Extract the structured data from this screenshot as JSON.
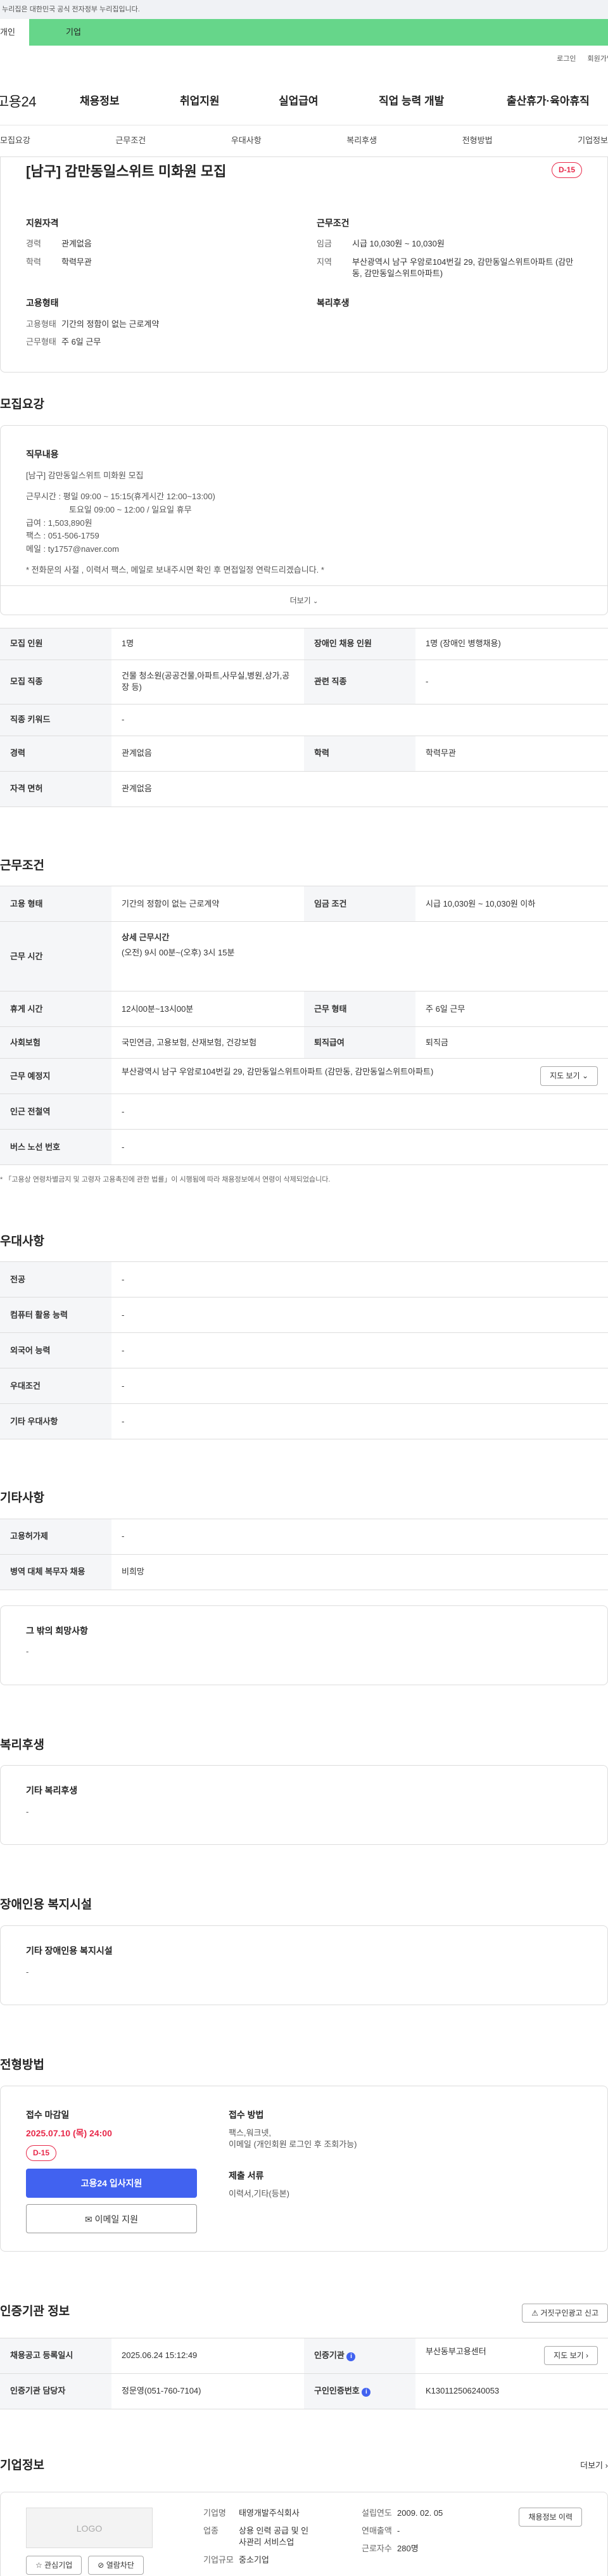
{
  "gov_banner": "이 누리집은 대한민국 공식 전자정부 누리집입니다.",
  "sub_tabs": [
    "개인",
    "기업"
  ],
  "util_links": [
    "로그인",
    "회원가입"
  ],
  "logo": "고용24",
  "gnb": [
    "채용정보",
    "취업지원",
    "실업급여",
    "직업 능력 개발",
    "출산휴가·육아휴직"
  ],
  "anchors": [
    "모집요강",
    "근무조건",
    "우대사항",
    "복리후생",
    "전형방법",
    "기업정보"
  ],
  "header": {
    "title": "[남구] 감만동일스위트 미화원 모집",
    "dday": "D-15",
    "qual_heading": "지원자격",
    "cond_heading": "근무조건",
    "emp_heading": "고용형태",
    "welfare_heading": "복리후생",
    "qual": [
      {
        "k": "경력",
        "v": "관계없음"
      },
      {
        "k": "학력",
        "v": "학력무관"
      }
    ],
    "cond": [
      {
        "k": "임금",
        "v": "시급 10,030원 ~ 10,030원"
      },
      {
        "k": "지역",
        "v": "부산광역시 남구 우암로104번길 29, 감만동일스위트아파트 (감만동, 감만동일스위트아파트)"
      }
    ],
    "emp": [
      {
        "k": "고용형태",
        "v": "기간의 정함이 없는 근로계약"
      },
      {
        "k": "근무형태",
        "v": "주 6일 근무"
      }
    ]
  },
  "recruit": {
    "section_title": "모집요강",
    "duty_heading": "직무내용",
    "duty_lines": [
      "[남구] 감만동일스위트 미화원 모집",
      "",
      "근무시간 : 평일 09:00 ~ 15:15(휴게시간 12:00~13:00)",
      "            토요일 09:00 ~ 12:00 / 일요일 휴무",
      "급여 : 1,503,890원",
      "팩스 : 051-506-1759",
      "메일 : ty1757@naver.com",
      "",
      "* 전화문의 사절 , 이력서 팩스, 메일로 보내주시면 확인 후 면접일정 연락드리겠습니다. *"
    ],
    "more": "더보기",
    "rows": [
      {
        "k1": "모집 인원",
        "v1": "1명",
        "k2": "장애인 채용 인원",
        "v2": "1명 (장애인 병행채용)"
      },
      {
        "k1": "모집 직종",
        "v1": "건물 청소원(공공건물,아파트,사무실,병원,상가,공장 등)",
        "k2": "관련 직종",
        "v2": "-"
      },
      {
        "k1": "직종 키워드",
        "v1": "-"
      },
      {
        "k1": "경력",
        "v1": "관계없음",
        "k2": "학력",
        "v2": "학력무관"
      },
      {
        "k1": "자격 면허",
        "v1": "관계없음"
      }
    ]
  },
  "conditions": {
    "section_title": "근무조건",
    "employ_type_k": "고용 형태",
    "employ_type_v": "기간의 정함이 없는 근로계약",
    "wage_k": "임금 조건",
    "wage_v": "시급 10,030원 ~ 10,030원 이하",
    "hours_k": "근무 시간",
    "hours_sub": "상세 근무시간",
    "hours_v": "(오전) 9시 00분~(오후) 3시 15분",
    "rest_k": "휴게 시간",
    "rest_v": "12시00분~13시00분",
    "form_k": "근무 형태",
    "form_v": "주 6일 근무",
    "ins_k": "사회보험",
    "ins_v": "국민연금, 고용보험, 산재보험, 건강보험",
    "sev_k": "퇴직급여",
    "sev_v": "퇴직금",
    "loc_k": "근무 예정지",
    "loc_v": "부산광역시 남구 우암로104번길 29, 감만동일스위트아파트 (감만동, 감만동일스위트아파트)",
    "map_btn": "지도 보기",
    "subway_k": "인근 전철역",
    "subway_v": "-",
    "bus_k": "버스 노선 번호",
    "bus_v": "-",
    "note": "* 「고용상 연령차별금지 및 고령자 고용촉진에 관한 법률」이 시행됨에 따라 채용정보에서 연령이 삭제되었습니다."
  },
  "preference": {
    "section_title": "우대사항",
    "rows": [
      {
        "k": "전공",
        "v": "-"
      },
      {
        "k": "컴퓨터 활용 능력",
        "v": "-"
      },
      {
        "k": "외국어 능력",
        "v": "-"
      },
      {
        "k": "우대조건",
        "v": "-"
      },
      {
        "k": "기타 우대사항",
        "v": "-"
      }
    ]
  },
  "etc": {
    "section_title": "기타사항",
    "rows": [
      {
        "k": "고용허가제",
        "v": "-"
      },
      {
        "k": "병역 대체 복무자 채용",
        "v": "비희망"
      }
    ],
    "wish_title": "그 밖의 희망사항",
    "wish_v": "-"
  },
  "welfare": {
    "section_title": "복리후생",
    "panel_title": "기타 복리후생",
    "v": "-"
  },
  "disabled": {
    "section_title": "장애인용 복지시설",
    "panel_title": "기타 장애인용 복지시설",
    "v": "-"
  },
  "process": {
    "section_title": "전형방법",
    "deadline_title": "접수 마감일",
    "deadline": "2025.07.10 (목) 24:00",
    "dday": "D-15",
    "apply_btn": "고용24 입사지원",
    "email_btn": "이메일 지원",
    "method_title": "접수 방법",
    "method_lines": [
      "팩스,워크넷,",
      "이메일 (개인회원 로그인 후 조회가능)"
    ],
    "docs_title": "제출 서류",
    "docs": "이력서,기타(등본)"
  },
  "cert": {
    "section_title": "인증기관 정보",
    "report_btn": "거짓구인광고 신고",
    "reg_k": "채용공고 등록일시",
    "reg_v": "2025.06.24 15:12:49",
    "org_k": "인증기관",
    "org_v": "부산동부고용센터",
    "map_btn": "지도 보기",
    "mgr_k": "인증기관 담당자",
    "mgr_v": "정문영(051-760-7104)",
    "cert_k": "구인인증번호",
    "cert_v": "K130112506240053"
  },
  "company": {
    "section_title": "기업정보",
    "more": "더보기",
    "logo_text": "LOGO",
    "interest_btn": "관심기업",
    "block_btn": "열람차단",
    "name_k": "기업명",
    "name_v": "태영개발주식회사",
    "found_k": "설립연도",
    "found_v": "2009. 02. 05",
    "industry_k": "업종",
    "industry_v": "상용 인력 공급 및 인사관리 서비스업",
    "sales_k": "연매출액",
    "sales_v": "-",
    "emp_k": "근로자수",
    "emp_v": "280명",
    "size_k": "기업규모",
    "size_v": "중소기업",
    "hire_btn": "채용정보 이력"
  }
}
